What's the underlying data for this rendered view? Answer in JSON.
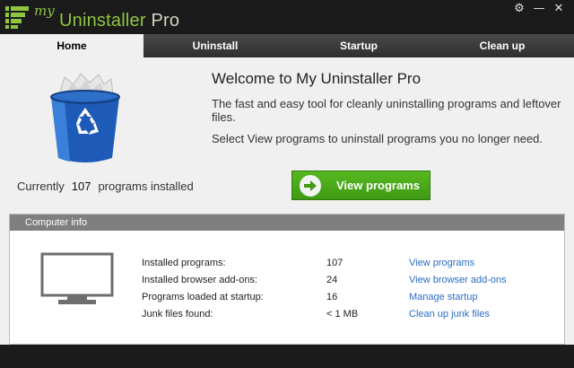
{
  "app": {
    "logo_my": "my",
    "logo_name_part1": "Uninstaller",
    "logo_name_part2": "Pro",
    "window_buttons": [
      "⚙",
      "—",
      "✕"
    ],
    "colors": {
      "accent_green": "#8ec63f",
      "button_green": "#4aa91a",
      "link_blue": "#2b6cc4"
    }
  },
  "tabs": [
    {
      "label": "Home",
      "active": true
    },
    {
      "label": "Uninstall",
      "active": false
    },
    {
      "label": "Startup",
      "active": false
    },
    {
      "label": "Clean up",
      "active": false
    }
  ],
  "home": {
    "welcome_title": "Welcome to My Uninstaller Pro",
    "welcome_subtitle": "The fast and easy tool for cleanly uninstalling programs and leftover files.",
    "welcome_hint": "Select View programs to uninstall programs you no longer need.",
    "installed_prefix": "Currently",
    "installed_count": "107",
    "installed_suffix": "programs installed",
    "view_button_label": "View programs",
    "view_button_icon": "arrow-right-icon"
  },
  "computer_info": {
    "header": "Computer info",
    "icon": "monitor-icon",
    "rows": [
      {
        "label": "Installed programs:",
        "value": "107",
        "action": "View programs"
      },
      {
        "label": "Installed browser add-ons:",
        "value": "24",
        "action": "View browser add-ons"
      },
      {
        "label": "Programs loaded at startup:",
        "value": "16",
        "action": "Manage startup"
      },
      {
        "label": "Junk files found:",
        "value": "< 1 MB",
        "action": "Clean up junk files"
      }
    ]
  }
}
